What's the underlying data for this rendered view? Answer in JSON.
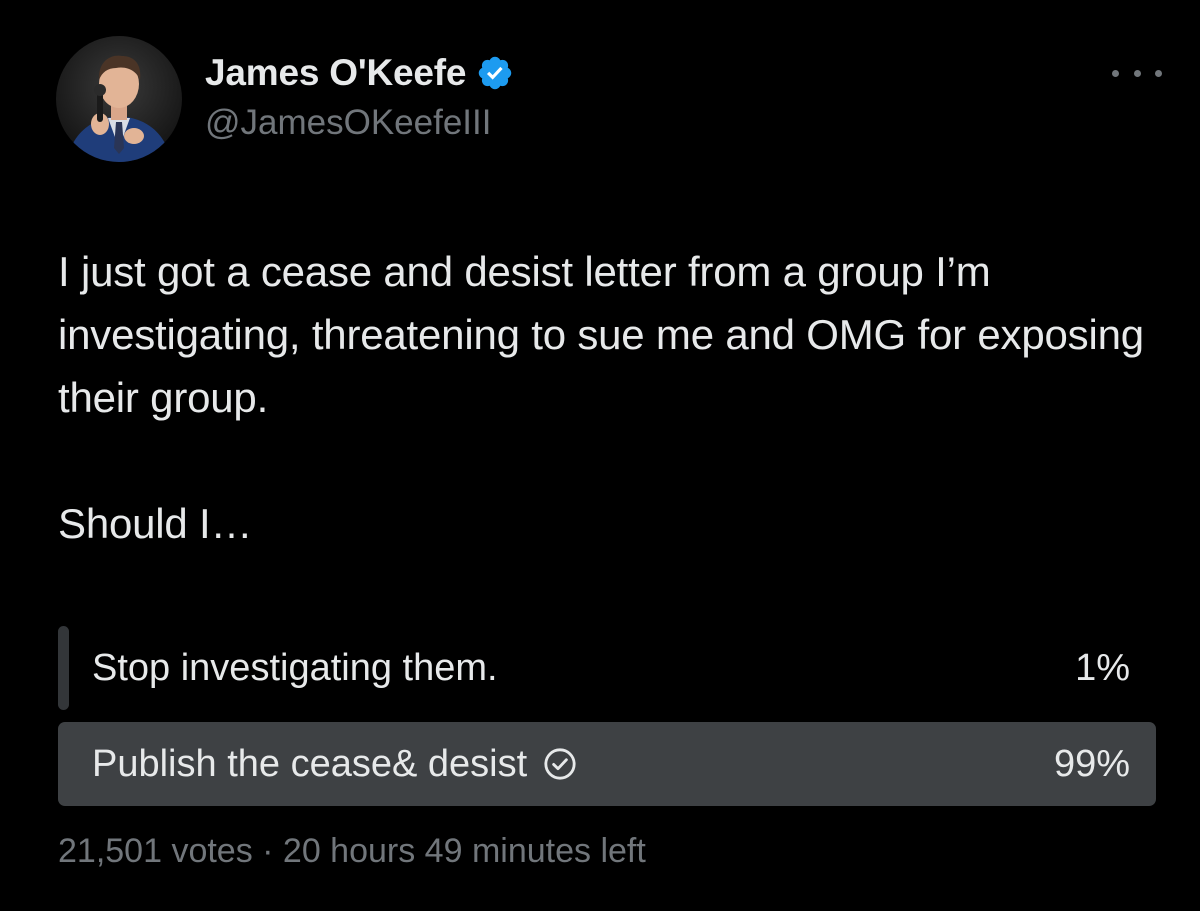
{
  "author": {
    "display_name": "James O'Keefe",
    "handle": "@JamesOKeefeIII",
    "verified_icon": "verified-badge-icon",
    "verified_color": "#1d9bf0"
  },
  "tweet": {
    "paragraphs": [
      "I just got a cease and desist letter from a group I’m investigating, threatening to sue me and OMG for exposing their group.",
      "Should I…"
    ]
  },
  "poll": {
    "options": [
      {
        "label": "Stop investigating them.",
        "percent_text": "1%",
        "percent": 1,
        "winner": false
      },
      {
        "label": "Publish the cease& desist",
        "percent_text": "99%",
        "percent": 99,
        "winner": true
      }
    ],
    "meta": "21,501 votes · 20 hours 49 minutes left"
  },
  "colors": {
    "background": "#000000",
    "text_primary": "#e7e9ea",
    "text_secondary": "#71767b",
    "poll_bar": "#333639"
  }
}
